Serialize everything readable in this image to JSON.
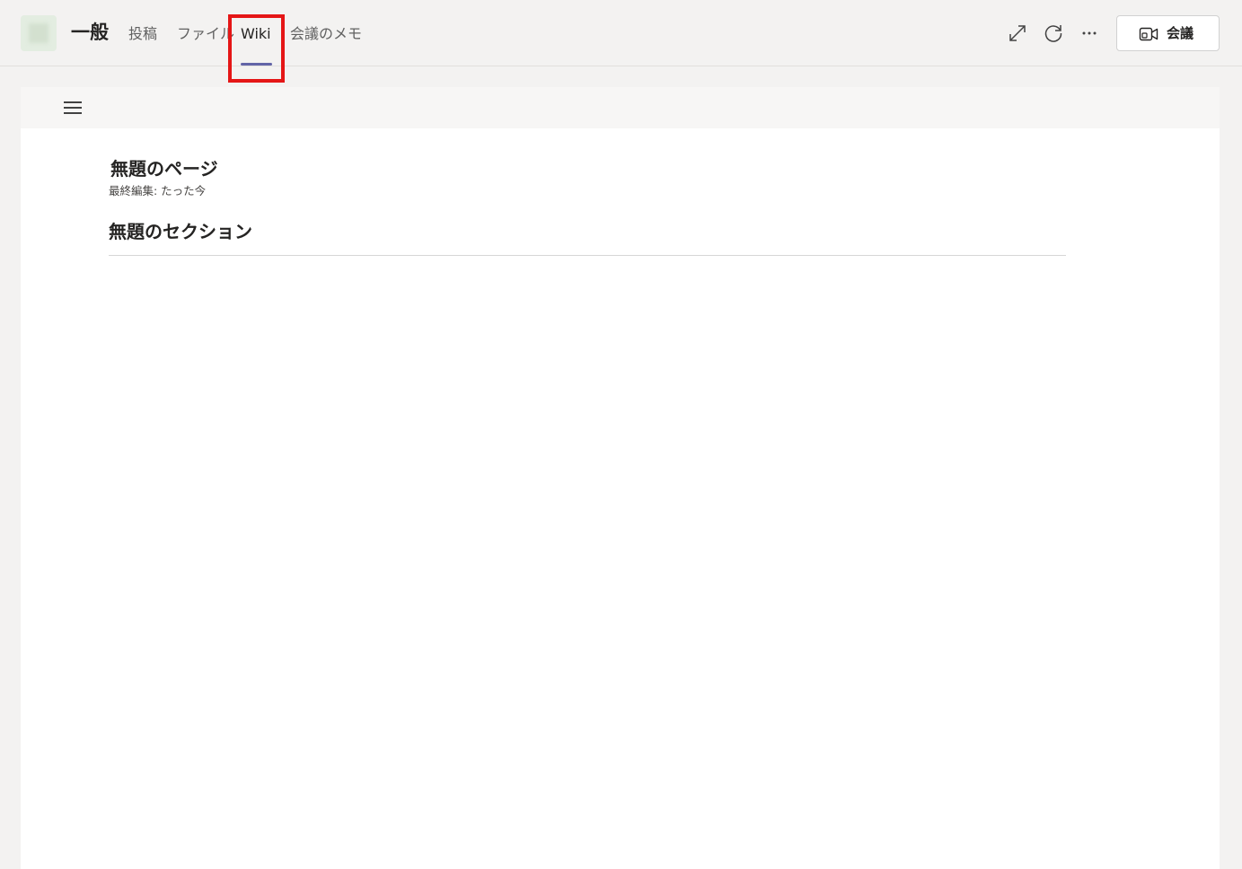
{
  "header": {
    "channel_name": "一般",
    "tabs": [
      {
        "label": "投稿"
      },
      {
        "label": "ファイル"
      },
      {
        "label": "Wiki"
      },
      {
        "label": "会議のメモ"
      }
    ],
    "active_tab": "Wiki",
    "actions": {
      "expand_icon": "expand-icon",
      "refresh_icon": "refresh-icon",
      "more_icon": "more-options-icon"
    },
    "meet_button": {
      "label": "会議",
      "icon": "video-camera-icon"
    }
  },
  "wiki": {
    "menu_icon": "hamburger-menu-icon",
    "page_title": "無題のページ",
    "last_edited": "最終編集: たった今",
    "section_title": "無題のセクション"
  },
  "colors": {
    "accent": "#6264a7",
    "highlight": "#e51616"
  }
}
